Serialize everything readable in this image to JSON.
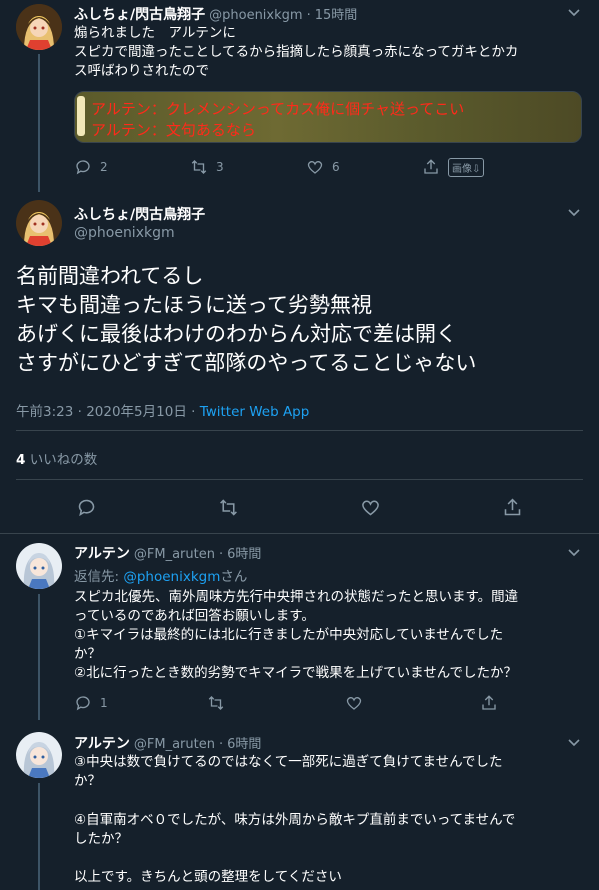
{
  "tweet1": {
    "name": "ふしちょ/閃古鳥翔子",
    "handle": "@phoenixkgm",
    "time": "15時間",
    "lines": [
      "煽られました　アルテンに",
      "スピカで間違ったことしてるから指摘したら顔真っ赤になってガキとかカ",
      "ス呼ばわりされたので"
    ],
    "image_lines": [
      "アルテン：クレメンシンってカス俺に個チャ送ってこい",
      "アルテン：文句あるなら"
    ],
    "reply_count": "2",
    "retweet_count": "3",
    "like_count": "6",
    "image_button": "画像⇩"
  },
  "main_tweet": {
    "name": "ふしちょ/閃古鳥翔子",
    "handle": "@phoenixkgm",
    "lines": [
      "名前間違われてるし",
      "キマも間違ったほうに送って劣勢無視",
      "あげくに最後はわけのわからん対応で差は開く",
      "さすがにひどすぎて部隊のやってることじゃない"
    ],
    "time": "午前3:23 · 2020年5月10日 · ",
    "client": "Twitter Web App",
    "likes_count": "4",
    "likes_label": "いいねの数"
  },
  "reply1": {
    "name": "アルテン",
    "handle": "@FM_aruten",
    "time": "6時間",
    "reply_to_prefix": "返信先: ",
    "reply_to_handle": "@phoenixkgm",
    "reply_to_suffix": "さん",
    "lines": [
      "スピカ北優先、南外周味方先行中央押されの状態だったと思います。間違",
      "っているのであれば回答お願いします。",
      "①キマイラは最終的には北に行きましたが中央対応していませんでした",
      "か？",
      "②北に行ったとき数的劣勢でキマイラで戦果を上げていませんでしたか？"
    ],
    "reply_count": "1"
  },
  "reply2": {
    "name": "アルテン",
    "handle": "@FM_aruten",
    "time": "6時間",
    "lines": [
      "③中央は数で負けてるのではなくて一部死に過ぎて負けてませんでした",
      "か？",
      "",
      "④自軍南オベ０でしたが、味方は外周から敵キプ直前までいってませんで",
      "したか？",
      "",
      "以上です。きちんと頭の整理をしてください"
    ]
  },
  "colors": {
    "background": "#15202b",
    "secondary_text": "#8899a6",
    "link": "#1da1f2",
    "divider": "#38444d"
  }
}
